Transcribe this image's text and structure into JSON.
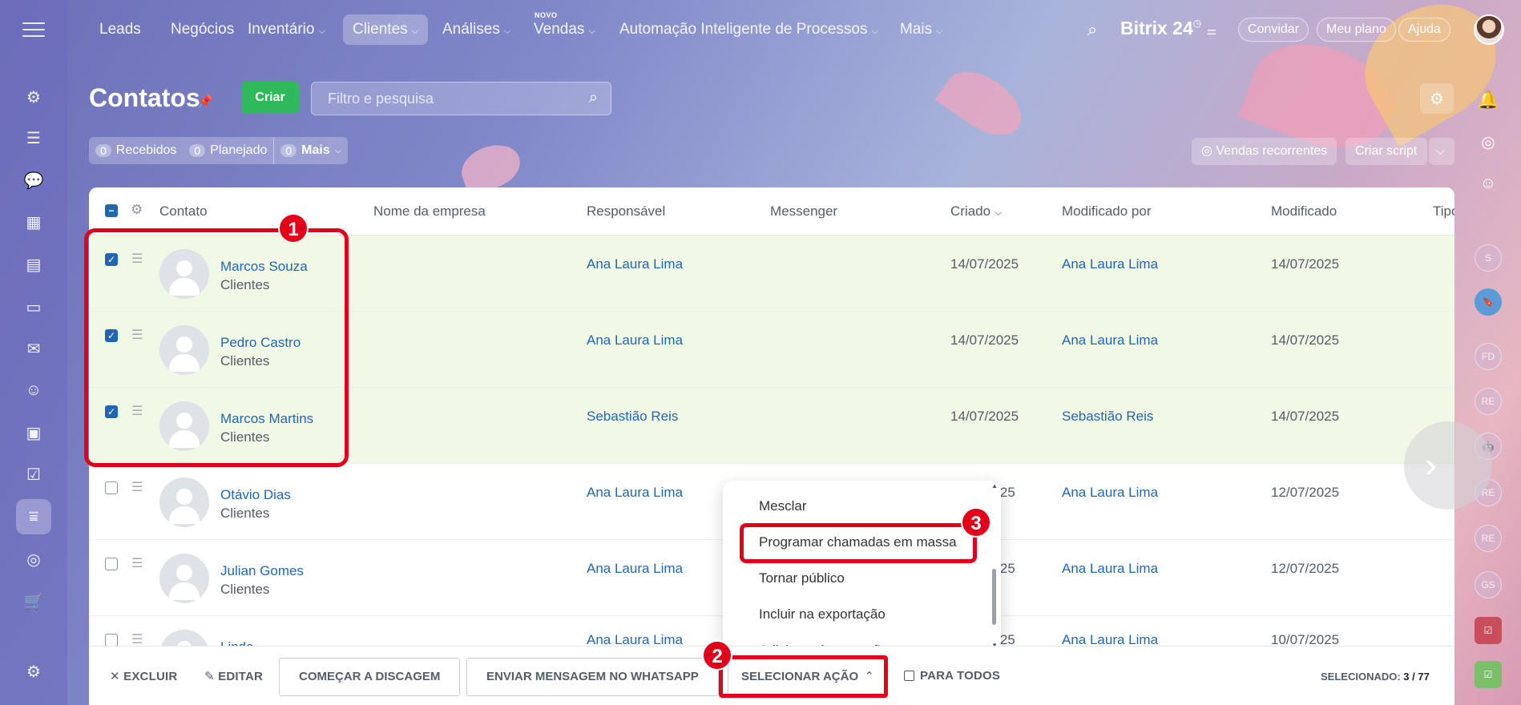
{
  "nav": {
    "items": [
      {
        "label": "Leads",
        "dropdown": false
      },
      {
        "label": "Negócios",
        "dropdown": false
      },
      {
        "label": "Inventário",
        "dropdown": true
      },
      {
        "label": "Clientes",
        "dropdown": true,
        "active": true
      },
      {
        "label": "Análises",
        "dropdown": true
      },
      {
        "label": "Vendas",
        "dropdown": true,
        "badge": "NOVO"
      },
      {
        "label": "Automação Inteligente de Processos",
        "dropdown": true
      },
      {
        "label": "Mais",
        "dropdown": true
      }
    ],
    "brand": "Bitrix 24",
    "invite": "Convidar",
    "plan": "Meu plano",
    "help": "Ajuda"
  },
  "page": {
    "title": "Contatos",
    "create": "Criar",
    "search_placeholder": "Filtro e pesquisa",
    "counters": [
      {
        "count": "0",
        "label": "Recebidos"
      },
      {
        "count": "0",
        "label": "Planejado"
      },
      {
        "count": "0",
        "label": "Mais"
      }
    ],
    "recurring_sales": "Vendas recorrentes",
    "create_script": "Criar script"
  },
  "table": {
    "headers": {
      "contact": "Contato",
      "company": "Nome da empresa",
      "responsible": "Responsável",
      "messenger": "Messenger",
      "created": "Criado",
      "modified_by": "Modificado por",
      "modified": "Modificado",
      "type": "Tipo"
    },
    "rows": [
      {
        "name": "Marcos Souza",
        "type": "Clientes",
        "responsible": "Ana Laura Lima",
        "created": "14/07/2025",
        "modified_by": "Ana Laura Lima",
        "modified": "14/07/2025",
        "checked": true
      },
      {
        "name": "Pedro Castro",
        "type": "Clientes",
        "responsible": "Ana Laura Lima",
        "created": "14/07/2025",
        "modified_by": "Ana Laura Lima",
        "modified": "14/07/2025",
        "checked": true
      },
      {
        "name": "Marcos Martins",
        "type": "Clientes",
        "responsible": "Sebastião Reis",
        "created": "14/07/2025",
        "modified_by": "Sebastião Reis",
        "modified": "14/07/2025",
        "checked": true
      },
      {
        "name": "Otávio Dias",
        "type": "Clientes",
        "responsible": "Ana Laura Lima",
        "created": "2025",
        "modified_by": "Ana Laura Lima",
        "modified": "12/07/2025",
        "checked": false
      },
      {
        "name": "Julian Gomes",
        "type": "Clientes",
        "responsible": "Ana Laura Lima",
        "created": "2025",
        "modified_by": "Ana Laura Lima",
        "modified": "12/07/2025",
        "checked": false
      },
      {
        "name": "Linda",
        "type": "",
        "responsible": "Ana Laura Lima",
        "created": "2025",
        "modified_by": "Ana Laura Lima",
        "modified": "10/07/2025",
        "checked": false
      }
    ]
  },
  "dropdown": {
    "items": [
      "Mesclar",
      "Programar chamadas em massa",
      "Tornar público",
      "Incluir na exportação",
      "Adicionar às exceções"
    ]
  },
  "actionbar": {
    "delete": "EXCLUIR",
    "edit": "EDITAR",
    "start_dialing": "COMEÇAR A DISCAGEM",
    "whatsapp": "ENVIAR MENSAGEM NO WHATSAPP",
    "select_action": "SELECIONAR AÇÃO",
    "for_all": "PARA TODOS",
    "selected_label": "SELECIONADO:",
    "selected_value": "3 / 77"
  },
  "annotations": [
    "1",
    "2",
    "3"
  ],
  "right_rail": [
    "S",
    "FD",
    "RE",
    "RE",
    "RE",
    "GS"
  ],
  "colors": {
    "accent": "#2067b0",
    "create": "#2fb95a",
    "highlight": "#e3001b",
    "selected_row": "#f1f8e6"
  }
}
